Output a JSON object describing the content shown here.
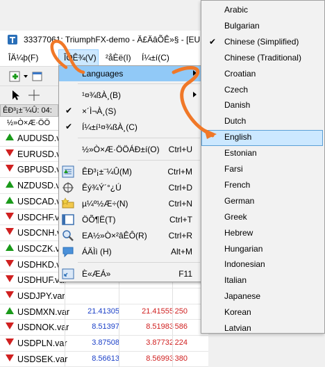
{
  "window": {
    "title": "33377061: TriumphFX-demo - Ä£ÄâÕÊ»§ - [EURUS"
  },
  "menubar": {
    "items": [
      "ÎÄ¼þ(F)",
      "ÎÓÊ¾(V)",
      "²åÈë(I)",
      "Í¼±í(C)"
    ]
  },
  "market_watch": {
    "header": "ÊÐ³¡±¨¼Û: 04:",
    "column_header": "½»Ò×Æ·ÖÖ",
    "rows": [
      {
        "symbol": "AUDUSD.var",
        "dir": "up"
      },
      {
        "symbol": "EURUSD.var",
        "dir": "down"
      },
      {
        "symbol": "GBPUSD.var",
        "dir": "down"
      },
      {
        "symbol": "NZDUSD.var",
        "dir": "up"
      },
      {
        "symbol": "USDCAD.var",
        "dir": "up"
      },
      {
        "symbol": "USDCHF.var",
        "dir": "down"
      },
      {
        "symbol": "USDCNH.var",
        "dir": "down"
      },
      {
        "symbol": "USDCZK.var",
        "dir": "up"
      },
      {
        "symbol": "USDHKD.var",
        "dir": "down"
      },
      {
        "symbol": "USDHUF.var",
        "dir": "down"
      },
      {
        "symbol": "USDJPY.var",
        "dir": "down"
      },
      {
        "symbol": "USDMXN.var",
        "dir": "up",
        "bid": "21.41305",
        "ask": "21.41555",
        "spread": "250"
      },
      {
        "symbol": "USDNOK.var",
        "dir": "down",
        "bid": "8.51397",
        "ask": "8.51983",
        "spread": "586"
      },
      {
        "symbol": "USDPLN.var",
        "dir": "down",
        "bid": "3.87508",
        "ask": "3.87732",
        "spread": "224"
      },
      {
        "symbol": "USDSEK.var",
        "dir": "down",
        "bid": "8.56613",
        "ask": "8.56993",
        "spread": "380"
      }
    ]
  },
  "view_menu": {
    "items": [
      {
        "label": "Languages",
        "submenu": true
      },
      {
        "label": "¹¤¾ßÀ¸(B)",
        "submenu": true
      },
      {
        "label": "×´Ì¬À¸(S)",
        "checked": true
      },
      {
        "label": "Í¼±í¹¤¾ßÀ¸(C)",
        "checked": true
      },
      {
        "label": "½»Ò×Æ·ÖÖÁÐ±í(O)",
        "shortcut": "Ctrl+U"
      },
      {
        "label": "ÊÐ³¡±¨¼Û(M)",
        "shortcut": "Ctrl+M",
        "icon": "market-watch-icon"
      },
      {
        "label": "Êý¾Ý´°¿Ú",
        "shortcut": "Ctrl+D",
        "icon": "crosshair-icon"
      },
      {
        "label": "µ¼º½Æ÷(N)",
        "shortcut": "Ctrl+N",
        "icon": "navigator-folder-icon"
      },
      {
        "label": "ÖÕ¶Ë(T)",
        "shortcut": "Ctrl+T",
        "icon": "terminal-icon"
      },
      {
        "label": "EA½»Ò×²âÊÔ(R)",
        "shortcut": "Ctrl+R",
        "icon": "strategy-tester-icon"
      },
      {
        "label": "ÁÄÌì (H)",
        "shortcut": "Alt+M",
        "icon": "chat-bubble-icon"
      },
      {
        "label": "È«ÆÁ»",
        "shortcut": "F11",
        "icon": "fullscreen-icon"
      }
    ]
  },
  "language_menu": {
    "items": [
      "Arabic",
      "Bulgarian",
      "Chinese (Simplified)",
      "Chinese (Traditional)",
      "Croatian",
      "Czech",
      "Danish",
      "Dutch",
      "English",
      "Estonian",
      "Farsi",
      "French",
      "German",
      "Greek",
      "Hebrew",
      "Hungarian",
      "Indonesian",
      "Italian",
      "Japanese",
      "Korean",
      "Latvian"
    ],
    "checked": "Chinese (Simplified)",
    "highlighted": "English"
  },
  "colors": {
    "menu_highlight": "#91c9f7",
    "hover_box": "#cce8ff",
    "annotation_arrow": "#f07828",
    "up": "#1a9a1a",
    "down": "#d02020",
    "bid_text": "#1a3fc8",
    "ask_text": "#d02020"
  }
}
